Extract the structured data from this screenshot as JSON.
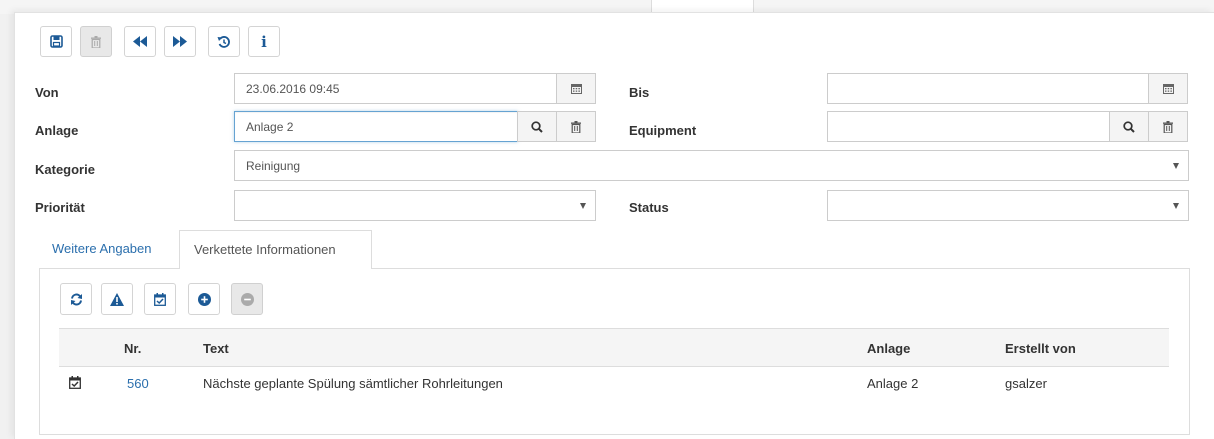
{
  "toolbar": {
    "buttons": [
      {
        "name": "save-button",
        "icon": "floppy-disk-icon",
        "enabled": true
      },
      {
        "name": "delete-button",
        "icon": "trash-icon",
        "enabled": false
      },
      {
        "name": "previous-button",
        "icon": "backward-icon",
        "enabled": true
      },
      {
        "name": "next-button",
        "icon": "forward-icon",
        "enabled": true
      },
      {
        "name": "history-button",
        "icon": "history-icon",
        "enabled": true
      },
      {
        "name": "info-button",
        "icon": "info-icon",
        "enabled": true
      }
    ]
  },
  "form": {
    "von_label": "Von",
    "von_value": "23.06.2016 09:45",
    "bis_label": "Bis",
    "bis_value": "",
    "anlage_label": "Anlage",
    "anlage_value": "Anlage 2",
    "equipment_label": "Equipment",
    "equipment_value": "",
    "kategorie_label": "Kategorie",
    "kategorie_value": "Reinigung",
    "prioritaet_label": "Priorität",
    "prioritaet_value": "",
    "status_label": "Status",
    "status_value": ""
  },
  "tabs": [
    {
      "label": "Weitere Angaben",
      "active": false
    },
    {
      "label": "Verkettete Informationen",
      "active": true
    }
  ],
  "subtoolbar": {
    "buttons": [
      {
        "name": "refresh-button",
        "icon": "refresh-icon",
        "enabled": true
      },
      {
        "name": "warning-button",
        "icon": "warning-icon",
        "enabled": true
      },
      {
        "name": "calendar-check-button",
        "icon": "calendar-check-icon",
        "enabled": true
      },
      {
        "name": "add-button",
        "icon": "plus-circle-icon",
        "enabled": true
      },
      {
        "name": "remove-button",
        "icon": "minus-circle-icon",
        "enabled": false
      }
    ]
  },
  "table": {
    "columns": [
      "Nr.",
      "Text",
      "Anlage",
      "Erstellt von"
    ],
    "rows": [
      {
        "icon": "calendar-check-icon",
        "nr": "560",
        "text": "Nächste geplante Spülung sämtlicher Rohrleitungen",
        "anlage": "Anlage 2",
        "erstellt_von": "gsalzer"
      }
    ]
  },
  "colors": {
    "accent": "#1c5a96",
    "link": "#2b6fad",
    "focus_border": "#66a3d2"
  }
}
